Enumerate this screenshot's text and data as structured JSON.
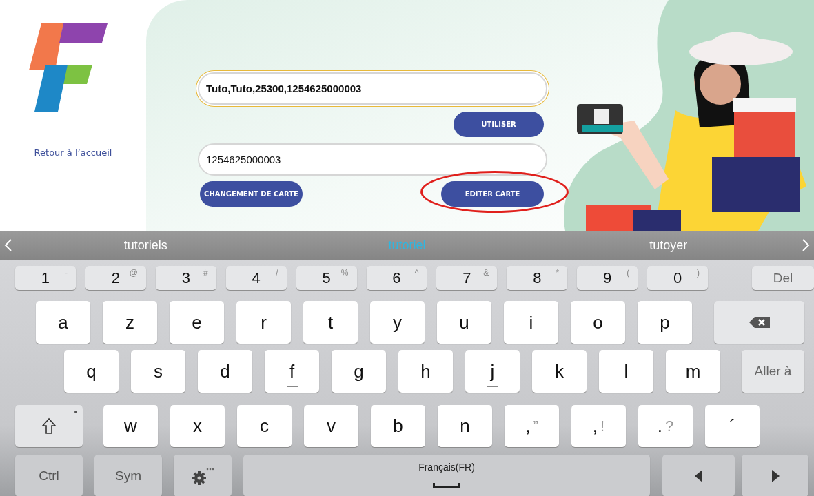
{
  "app": {
    "home_link": "Retour à l’accueil"
  },
  "form": {
    "fields": [
      {
        "value": "Tuto,Tuto,25300,1254625000003",
        "focused": true,
        "bold": true
      },
      {
        "value": "1254625000003",
        "focused": false,
        "bold": false
      }
    ],
    "use_button": "UTILISER",
    "change_button": "CHANGEMENT DE CARTE",
    "edit_button": {
      "label": "EDITER CARTE",
      "circled": true
    }
  },
  "suggestions": [
    {
      "text": "tutoriels",
      "selected": false
    },
    {
      "text": "tutoriel",
      "selected": true
    },
    {
      "text": "tutoyer",
      "selected": false
    }
  ],
  "keyboard": {
    "rows": [
      [
        {
          "kind": "num",
          "label": "1",
          "sub": "-"
        },
        {
          "kind": "num",
          "label": "2",
          "sub": "@"
        },
        {
          "kind": "num",
          "label": "3",
          "sub": "#"
        },
        {
          "kind": "num",
          "label": "4",
          "sub": "/"
        },
        {
          "kind": "num",
          "label": "5",
          "sub": "%"
        },
        {
          "kind": "num",
          "label": "6",
          "sub": "^"
        },
        {
          "kind": "num",
          "label": "7",
          "sub": "&"
        },
        {
          "kind": "num",
          "label": "8",
          "sub": "*"
        },
        {
          "kind": "num",
          "label": "9",
          "sub": "("
        },
        {
          "kind": "num",
          "label": "0",
          "sub": ")"
        },
        {
          "kind": "del",
          "label": "Del"
        }
      ],
      [
        {
          "kind": "letter",
          "label": "a"
        },
        {
          "kind": "letter",
          "label": "z"
        },
        {
          "kind": "letter",
          "label": "e"
        },
        {
          "kind": "letter",
          "label": "r"
        },
        {
          "kind": "letter",
          "label": "t"
        },
        {
          "kind": "letter",
          "label": "y"
        },
        {
          "kind": "letter",
          "label": "u"
        },
        {
          "kind": "letter",
          "label": "i"
        },
        {
          "kind": "letter",
          "label": "o"
        },
        {
          "kind": "letter",
          "label": "p"
        },
        {
          "kind": "backspace"
        }
      ],
      [
        {
          "kind": "letter",
          "label": "q"
        },
        {
          "kind": "letter",
          "label": "s"
        },
        {
          "kind": "letter",
          "label": "d"
        },
        {
          "kind": "home",
          "label": "f"
        },
        {
          "kind": "letter",
          "label": "g"
        },
        {
          "kind": "letter",
          "label": "h"
        },
        {
          "kind": "home",
          "label": "j"
        },
        {
          "kind": "letter",
          "label": "k"
        },
        {
          "kind": "letter",
          "label": "l"
        },
        {
          "kind": "letter",
          "label": "m"
        },
        {
          "kind": "enter",
          "label": "Aller à"
        }
      ],
      [
        {
          "kind": "shift"
        },
        {
          "kind": "letter",
          "label": "w"
        },
        {
          "kind": "letter",
          "label": "x"
        },
        {
          "kind": "letter",
          "label": "c"
        },
        {
          "kind": "letter",
          "label": "v"
        },
        {
          "kind": "letter",
          "label": "b"
        },
        {
          "kind": "letter",
          "label": "n"
        },
        {
          "kind": "punct",
          "label": ",",
          "sub": "”"
        },
        {
          "kind": "punct",
          "label": ",",
          "sub": "!"
        },
        {
          "kind": "punct",
          "label": ".",
          "sub": "?"
        },
        {
          "kind": "letter",
          "label": "´"
        }
      ],
      [
        {
          "kind": "ctrl",
          "label": "Ctrl"
        },
        {
          "kind": "sym",
          "label": "Sym"
        },
        {
          "kind": "gear"
        },
        {
          "kind": "space",
          "label": "Français(FR)"
        },
        {
          "kind": "left"
        },
        {
          "kind": "right"
        }
      ]
    ]
  }
}
